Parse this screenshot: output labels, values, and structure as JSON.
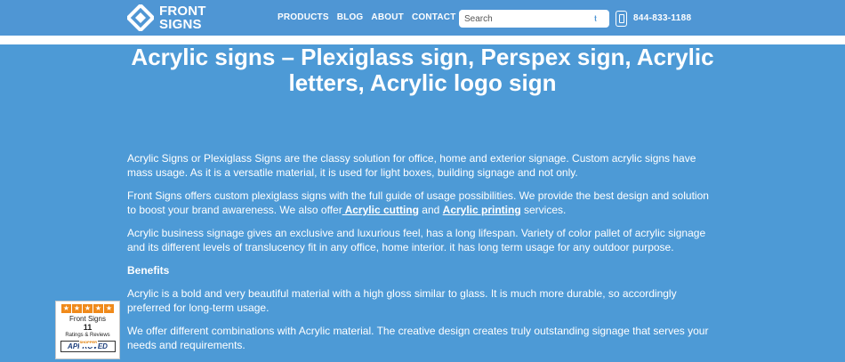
{
  "header": {
    "logo_line1": "FRONT",
    "logo_line2": "SIGNS",
    "nav": [
      "PRODUCTS",
      "BLOG",
      "ABOUT",
      "CONTACT"
    ],
    "search_placeholder": "Search",
    "phone": "844-833-1188",
    "colors": {
      "bar": "#4f96d4"
    }
  },
  "main": {
    "title": "Acrylic signs – Plexiglass sign, Perspex sign, Acrylic letters, Acrylic logo sign",
    "p1": "Acrylic Signs or Plexiglass Signs are the classy solution for office, home and exterior signage. Custom acrylic signs have mass usage. As it is a versatile material, it is used for light boxes, building signage and not only.",
    "p2_before": "Front Signs offers custom plexiglass signs with the full guide of usage possibilities. We provide the best design and solution to boost your brand awareness. We also offer",
    "p2_link1": " Acrylic cutting",
    "p2_mid": " and ",
    "p2_link2": "Acrylic printing",
    "p2_after": " services.",
    "p3": "Acrylic business signage gives an exclusive and luxurious feel, has a long lifespan. Variety of color pallet of acrylic signage and its different levels of translucency fit in any office, home interior. it has long term usage for any outdoor purpose.",
    "benefits_heading": "Benefits",
    "p4": "Acrylic is a bold and very beautiful material with a high gloss similar to glass. It is much more durable, so accordingly preferred for long-term usage.",
    "p5": "We offer different combinations with Acrylic material. The creative design creates truly outstanding signage that serves your needs and requirements.",
    "colors": {
      "background": "#4d9ad6"
    }
  },
  "badge": {
    "stars": 5,
    "name": "Front Signs",
    "count": "11",
    "subtitle": "Ratings & Reviews",
    "tag": "SHOPPER",
    "approved": "APPROVED"
  }
}
